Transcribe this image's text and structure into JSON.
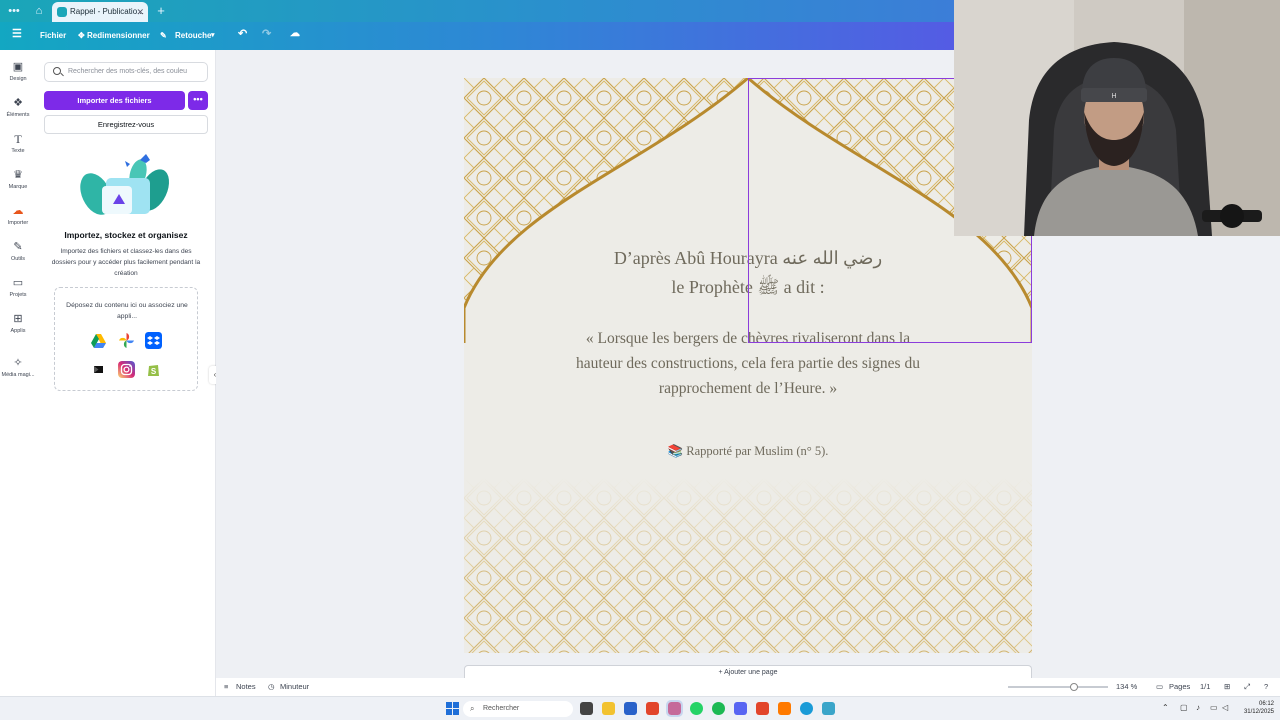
{
  "browser": {
    "tab_title": "Rappel - Publicatio...",
    "new_tab": "+"
  },
  "header": {
    "menu_icon": "hamburger-icon",
    "file": "Fichier",
    "resize": "Redimensionner",
    "edit": "Retouche"
  },
  "rail": [
    {
      "label": "Design",
      "icon": "design-icon"
    },
    {
      "label": "Éléments",
      "icon": "elements-icon"
    },
    {
      "label": "Texte",
      "icon": "text-icon"
    },
    {
      "label": "Marque",
      "icon": "brand-icon"
    },
    {
      "label": "Importer",
      "icon": "upload-icon"
    },
    {
      "label": "Outils",
      "icon": "tools-icon"
    },
    {
      "label": "Projets",
      "icon": "folder-icon"
    },
    {
      "label": "Applis",
      "icon": "apps-icon"
    },
    {
      "label": "Média magi...",
      "icon": "magic-media-icon"
    }
  ],
  "panel": {
    "search_placeholder": "Rechercher des mots-clés, des couleu",
    "import_button": "Importer des fichiers",
    "more_button": "•••",
    "record_button": "Enregistrez-vous",
    "title": "Importez, stockez et organisez",
    "description": "Importez des fichiers et classez-les dans des dossiers pour y accéder plus facilement pendant la création",
    "drop_text": "Déposez du contenu ici ou associez une appli...",
    "apps": [
      "google-drive-icon",
      "google-photos-icon",
      "dropbox-icon",
      "capcut-icon",
      "instagram-icon",
      "shopify-icon"
    ]
  },
  "page": {
    "line1": "D’après Abû Hourayra رضي الله عنه",
    "line2": "le Prophète ﷺ a dit :",
    "quote_line1": "« Lorsque les bergers de chèvres rivaliseront dans la",
    "quote_line2": "hauteur des constructions, cela fera partie des signes du",
    "quote_line3": "rapprochement de l’Heure. »",
    "source": "📚 Rapporté par Muslim (n° 5)."
  },
  "add_page": "+ Ajouter une page",
  "footer": {
    "notes": "Notes",
    "timer": "Minuteur",
    "zoom": "134 %",
    "pages": "Pages",
    "page_count": "1/1"
  },
  "taskbar": {
    "search": "Rechercher",
    "time": "06:12",
    "date": "31/12/2025"
  },
  "colors": {
    "accent": "#7d2ae8",
    "gold": "#c9a24a",
    "page_bg": "#edece7"
  }
}
